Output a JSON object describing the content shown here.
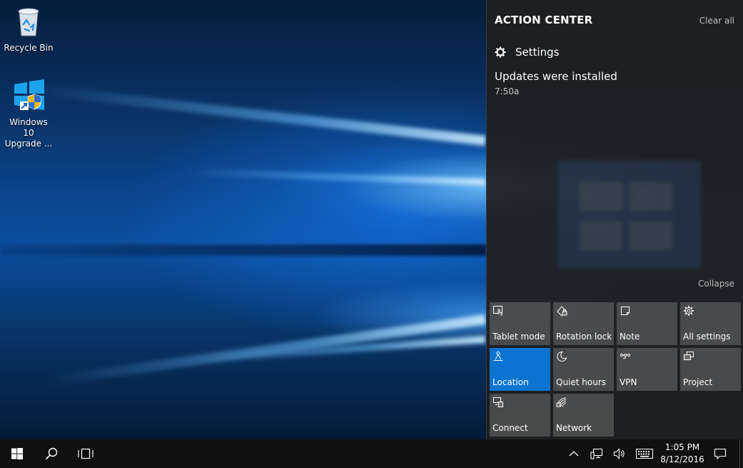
{
  "desktop": {
    "icons": [
      {
        "label": "Recycle Bin",
        "icon": "recycle-bin-icon"
      },
      {
        "label": "Windows 10\nUpgrade ...",
        "icon": "windows-upgrade-icon"
      }
    ],
    "wallpaper": {
      "accent": "#0b5fd0",
      "dark": "#041a37"
    }
  },
  "action_center": {
    "title": "ACTION CENTER",
    "clear_all": "Clear all",
    "notification_group": {
      "app": "Settings",
      "icon": "gear-icon",
      "notifications": [
        {
          "title": "Updates were installed",
          "time": "7:50a"
        }
      ]
    },
    "collapse": "Collapse",
    "quick_actions": [
      {
        "label": "Tablet mode",
        "icon": "tablet-mode-icon",
        "active": false
      },
      {
        "label": "Rotation lock",
        "icon": "rotation-lock-icon",
        "active": false
      },
      {
        "label": "Note",
        "icon": "note-icon",
        "active": false
      },
      {
        "label": "All settings",
        "icon": "gear-icon",
        "active": false
      },
      {
        "label": "Location",
        "icon": "location-icon",
        "active": true
      },
      {
        "label": "Quiet hours",
        "icon": "moon-icon",
        "active": false
      },
      {
        "label": "VPN",
        "icon": "vpn-icon",
        "active": false
      },
      {
        "label": "Project",
        "icon": "project-icon",
        "active": false
      },
      {
        "label": "Connect",
        "icon": "connect-icon",
        "active": false
      },
      {
        "label": "Network",
        "icon": "network-icon",
        "active": false
      }
    ],
    "colors": {
      "panel": "#1f1f1f",
      "tile": "#6e6e6e",
      "tile_active": "#0a74d0"
    }
  },
  "taskbar": {
    "buttons": [
      "start-icon",
      "search-icon",
      "task-view-icon"
    ],
    "tray": [
      "chevron-up-icon",
      "network-wired-icon",
      "volume-icon",
      "keyboard-icon"
    ],
    "clock": {
      "time": "1:05 PM",
      "date": "8/12/2016"
    },
    "action_center_button": "action-center-icon"
  }
}
